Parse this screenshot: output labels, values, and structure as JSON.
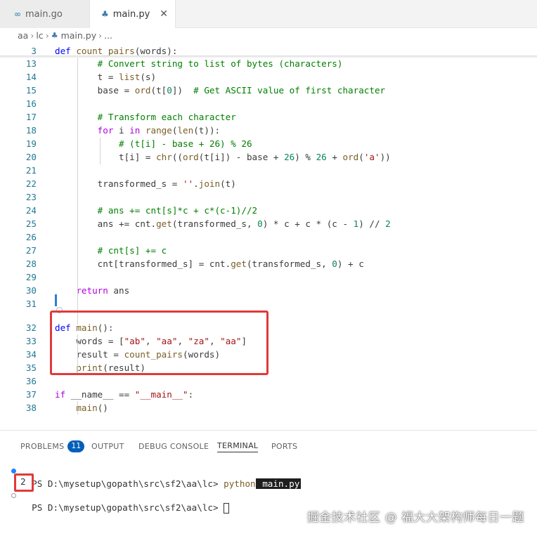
{
  "tabs": [
    {
      "label": "main.go",
      "icon": "go-file-icon"
    },
    {
      "label": "main.py",
      "icon": "python-file-icon",
      "close": "✕"
    }
  ],
  "breadcrumb": {
    "parts": [
      "aa",
      "lc",
      "main.py",
      "..."
    ]
  },
  "editor": {
    "lines": [
      {
        "n": "3",
        "code": "def count_pairs(words):"
      },
      {
        "n": "13",
        "code": "        # Convert string to list of bytes (characters)"
      },
      {
        "n": "14",
        "code": "        t = list(s)"
      },
      {
        "n": "15",
        "code": "        base = ord(t[0])  # Get ASCII value of first character"
      },
      {
        "n": "16",
        "code": ""
      },
      {
        "n": "17",
        "code": "        # Transform each character"
      },
      {
        "n": "18",
        "code": "        for i in range(len(t)):"
      },
      {
        "n": "19",
        "code": "            # (t[i] - base + 26) % 26"
      },
      {
        "n": "20",
        "code": "            t[i] = chr((ord(t[i]) - base + 26) % 26 + ord('a'))"
      },
      {
        "n": "21",
        "code": ""
      },
      {
        "n": "22",
        "code": "        transformed_s = ''.join(t)"
      },
      {
        "n": "23",
        "code": ""
      },
      {
        "n": "24",
        "code": "        # ans += cnt[s]*c + c*(c-1)//2"
      },
      {
        "n": "25",
        "code": "        ans += cnt.get(transformed_s, 0) * c + c * (c - 1) // 2"
      },
      {
        "n": "26",
        "code": ""
      },
      {
        "n": "27",
        "code": "        # cnt[s] += c"
      },
      {
        "n": "28",
        "code": "        cnt[transformed_s] = cnt.get(transformed_s, 0) + c"
      },
      {
        "n": "29",
        "code": ""
      },
      {
        "n": "30",
        "code": "    return ans"
      },
      {
        "n": "31",
        "code": ""
      },
      {
        "n": "32",
        "code": "def main():"
      },
      {
        "n": "33",
        "code": "    words = [\"ab\", \"aa\", \"za\", \"aa\"]"
      },
      {
        "n": "34",
        "code": "    result = count_pairs(words)"
      },
      {
        "n": "35",
        "code": "    print(result)"
      },
      {
        "n": "36",
        "code": ""
      },
      {
        "n": "37",
        "code": "if __name__ == \"__main__\":"
      },
      {
        "n": "38",
        "code": "    main()"
      }
    ]
  },
  "panel": {
    "tabs": [
      "PROBLEMS",
      "OUTPUT",
      "DEBUG CONSOLE",
      "TERMINAL",
      "PORTS"
    ],
    "problems_count": "11",
    "active_tab": "TERMINAL",
    "terminal": {
      "prompt1": "PS D:\\mysetup\\gopath\\src\\sf2\\aa\\lc> ",
      "command": "python",
      "argument": " main.py",
      "output": "2",
      "prompt2": "PS D:\\mysetup\\gopath\\src\\sf2\\aa\\lc> "
    }
  },
  "watermark": "掘金技术社区 @ 福大大架构师每日一题",
  "colors": {
    "keyword": "#af00db",
    "def": "#0000ff",
    "function": "#795e26",
    "string": "#a31515",
    "comment": "#008000",
    "number": "#098658",
    "highlight": "#e03a3a",
    "badge": "#005fb8"
  }
}
